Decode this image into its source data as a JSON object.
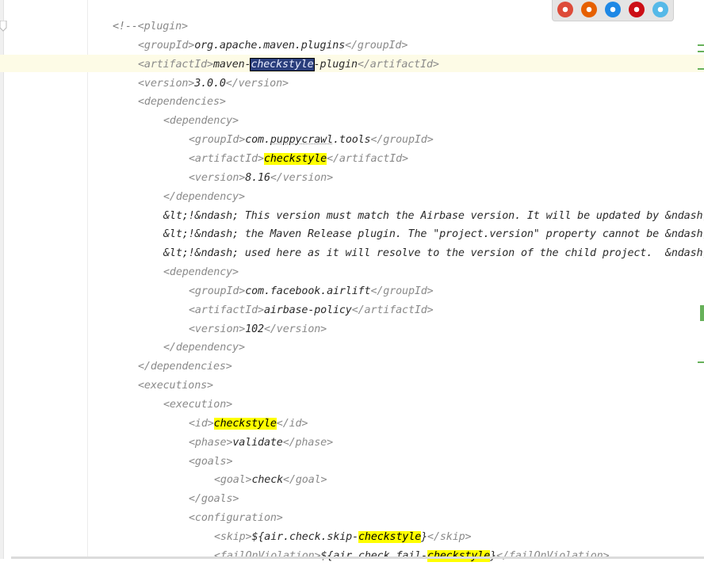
{
  "editor": {
    "lines": [
      {
        "indent": 0,
        "parts": [
          {
            "text": "<!--",
            "k": "c"
          },
          {
            "text": "<plugin>",
            "k": "t"
          }
        ]
      },
      {
        "indent": 1,
        "parts": [
          {
            "text": "<groupId>",
            "k": "t"
          },
          {
            "text": "org.apache.maven.plugins",
            "k": "v"
          },
          {
            "text": "</groupId>",
            "k": "t"
          }
        ]
      },
      {
        "indent": 1,
        "parts": [
          {
            "text": "<artifactId>",
            "k": "t"
          },
          {
            "text": "maven-",
            "k": "v"
          },
          {
            "text": "checkstyle",
            "k": "sel"
          },
          {
            "text": "-plugin",
            "k": "v"
          },
          {
            "text": "</artifactId>",
            "k": "t"
          }
        ]
      },
      {
        "indent": 1,
        "parts": [
          {
            "text": "<version>",
            "k": "t"
          },
          {
            "text": "3.0.0",
            "k": "v"
          },
          {
            "text": "</version>",
            "k": "t"
          }
        ]
      },
      {
        "indent": 1,
        "parts": [
          {
            "text": "<dependencies>",
            "k": "t"
          }
        ]
      },
      {
        "indent": 2,
        "parts": [
          {
            "text": "<dependency>",
            "k": "t"
          }
        ]
      },
      {
        "indent": 3,
        "parts": [
          {
            "text": "<groupId>",
            "k": "t"
          },
          {
            "text": "com.",
            "k": "v"
          },
          {
            "text": "puppycrawl",
            "k": "u"
          },
          {
            "text": ".tools",
            "k": "v"
          },
          {
            "text": "</groupId>",
            "k": "t"
          }
        ]
      },
      {
        "indent": 3,
        "parts": [
          {
            "text": "<artifactId>",
            "k": "t"
          },
          {
            "text": "checkstyle",
            "k": "hl"
          },
          {
            "text": "</artifactId>",
            "k": "t"
          }
        ]
      },
      {
        "indent": 3,
        "parts": [
          {
            "text": "<version>",
            "k": "t"
          },
          {
            "text": "8.16",
            "k": "v"
          },
          {
            "text": "</version>",
            "k": "t"
          }
        ]
      },
      {
        "indent": 2,
        "parts": [
          {
            "text": "</dependency>",
            "k": "t"
          }
        ]
      },
      {
        "indent": 2,
        "parts": [
          {
            "text": "&lt;!&ndash; This version must match the Airbase version. It will be updated by &ndash;",
            "k": "v"
          }
        ]
      },
      {
        "indent": 2,
        "parts": [
          {
            "text": "&lt;!&ndash; the Maven Release plugin. The \"project.version\" property cannot be &ndash;",
            "k": "v"
          }
        ]
      },
      {
        "indent": 2,
        "parts": [
          {
            "text": "&lt;!&ndash; used here as it will resolve to the version of the child project.  &ndash;",
            "k": "v"
          }
        ]
      },
      {
        "indent": 2,
        "parts": [
          {
            "text": "<dependency>",
            "k": "t"
          }
        ]
      },
      {
        "indent": 3,
        "parts": [
          {
            "text": "<groupId>",
            "k": "t"
          },
          {
            "text": "com.facebook.airlift",
            "k": "v"
          },
          {
            "text": "</groupId>",
            "k": "t"
          }
        ]
      },
      {
        "indent": 3,
        "parts": [
          {
            "text": "<artifactId>",
            "k": "t"
          },
          {
            "text": "airbase-policy",
            "k": "v"
          },
          {
            "text": "</artifactId>",
            "k": "t"
          }
        ]
      },
      {
        "indent": 3,
        "parts": [
          {
            "text": "<version>",
            "k": "t"
          },
          {
            "text": "102",
            "k": "v"
          },
          {
            "text": "</version>",
            "k": "t"
          }
        ]
      },
      {
        "indent": 2,
        "parts": [
          {
            "text": "</dependency>",
            "k": "t"
          }
        ]
      },
      {
        "indent": 1,
        "parts": [
          {
            "text": "</dependencies>",
            "k": "t"
          }
        ]
      },
      {
        "indent": 1,
        "parts": [
          {
            "text": "<executions>",
            "k": "t"
          }
        ]
      },
      {
        "indent": 2,
        "parts": [
          {
            "text": "<execution>",
            "k": "t"
          }
        ]
      },
      {
        "indent": 3,
        "parts": [
          {
            "text": "<id>",
            "k": "t"
          },
          {
            "text": "checkstyle",
            "k": "hl"
          },
          {
            "text": "</id>",
            "k": "t"
          }
        ]
      },
      {
        "indent": 3,
        "parts": [
          {
            "text": "<phase>",
            "k": "t"
          },
          {
            "text": "validate",
            "k": "v"
          },
          {
            "text": "</phase>",
            "k": "t"
          }
        ]
      },
      {
        "indent": 3,
        "parts": [
          {
            "text": "<goals>",
            "k": "t"
          }
        ]
      },
      {
        "indent": 4,
        "parts": [
          {
            "text": "<goal>",
            "k": "t"
          },
          {
            "text": "check",
            "k": "v"
          },
          {
            "text": "</goal>",
            "k": "t"
          }
        ]
      },
      {
        "indent": 3,
        "parts": [
          {
            "text": "</goals>",
            "k": "t"
          }
        ]
      },
      {
        "indent": 3,
        "parts": [
          {
            "text": "<configuration>",
            "k": "t"
          }
        ]
      },
      {
        "indent": 4,
        "parts": [
          {
            "text": "<skip>",
            "k": "t"
          },
          {
            "text": "${air.check.skip-",
            "k": "v"
          },
          {
            "text": "checkstyle",
            "k": "hl"
          },
          {
            "text": "}",
            "k": "v"
          },
          {
            "text": "</skip>",
            "k": "t"
          }
        ]
      },
      {
        "indent": 4,
        "parts": [
          {
            "text": "<failOnViolation>",
            "k": "t"
          },
          {
            "text": "${air.check.fail-",
            "k": "v"
          },
          {
            "text": "checkstyle",
            "k": "hl"
          },
          {
            "text": "}",
            "k": "v"
          },
          {
            "text": "</failOnViolation>",
            "k": "t"
          }
        ]
      }
    ]
  },
  "browser_icons": [
    {
      "name": "chrome-icon",
      "color": "#dd4b39"
    },
    {
      "name": "firefox-icon",
      "color": "#e66000"
    },
    {
      "name": "safari-icon",
      "color": "#1e88e5"
    },
    {
      "name": "opera-icon",
      "color": "#cc0f16"
    },
    {
      "name": "ie-icon",
      "color": "#55b9e8"
    }
  ]
}
